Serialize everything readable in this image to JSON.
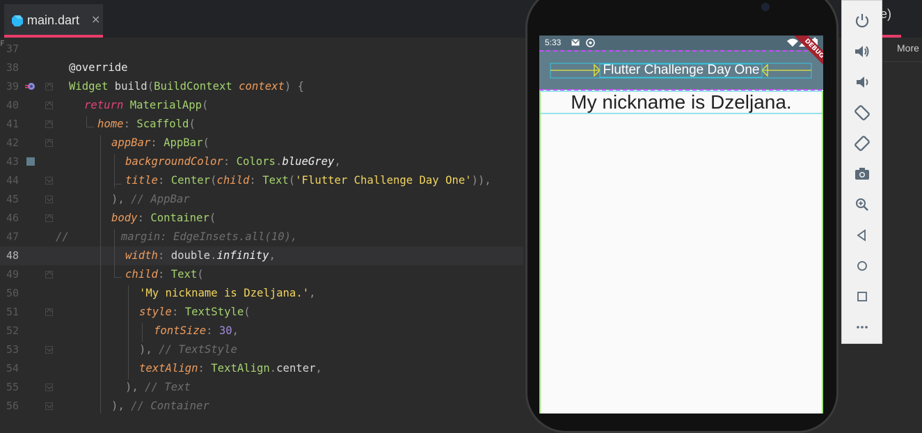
{
  "editor": {
    "tab": {
      "icon": "dart-file-icon",
      "label": "main.dart",
      "close": "×"
    },
    "edge_marker": "F",
    "current_line": 48,
    "lines": [
      {
        "num": "37",
        "text": ""
      },
      {
        "num": "38",
        "text": "@override"
      },
      {
        "num": "39",
        "text": "Widget build(BuildContext context) {"
      },
      {
        "num": "40",
        "text": "return MaterialApp("
      },
      {
        "num": "41",
        "text": "home: Scaffold("
      },
      {
        "num": "42",
        "text": "appBar: AppBar("
      },
      {
        "num": "43",
        "text": "backgroundColor: Colors.blueGrey,"
      },
      {
        "num": "44",
        "text": "title: Center(child: Text('Flutter Challenge Day One')),"
      },
      {
        "num": "45",
        "text": "), // AppBar"
      },
      {
        "num": "46",
        "text": "body: Container("
      },
      {
        "num": "47",
        "text": "//        margin: EdgeInsets.all(10),"
      },
      {
        "num": "48",
        "text": "width: double.infinity,"
      },
      {
        "num": "49",
        "text": "child: Text("
      },
      {
        "num": "50",
        "text": "'My nickname is Dzeljana.',"
      },
      {
        "num": "51",
        "text": "style: TextStyle("
      },
      {
        "num": "52",
        "text": "fontSize: 30,"
      },
      {
        "num": "53",
        "text": "), // TextStyle"
      },
      {
        "num": "54",
        "text": "textAlign: TextAlign.center,"
      },
      {
        "num": "55",
        "text": "), // Text"
      },
      {
        "num": "56",
        "text": "), // Container"
      }
    ]
  },
  "right_panel": {
    "tab_fragment": "e)",
    "more_button": "More"
  },
  "emulator": {
    "status_time": "5:33",
    "status_icons": [
      "gmail-icon",
      "sync-icon",
      "wifi-icon",
      "signal-icon",
      "battery-icon"
    ],
    "app_bar_title": "Flutter Challenge Day One",
    "body_text": "My nickname is Dzeljana.",
    "debug_banner": "DEBUG",
    "colors": {
      "app_bar": "#607d8b",
      "status_bar": "#4f6875",
      "debug_banner": "#a4222e"
    },
    "toolbar": [
      "power-icon",
      "volume-up-icon",
      "volume-down-icon",
      "rotate-left-icon",
      "rotate-right-icon",
      "camera-icon",
      "zoom-icon",
      "back-icon",
      "home-icon",
      "overview-icon",
      "more-icon"
    ]
  }
}
